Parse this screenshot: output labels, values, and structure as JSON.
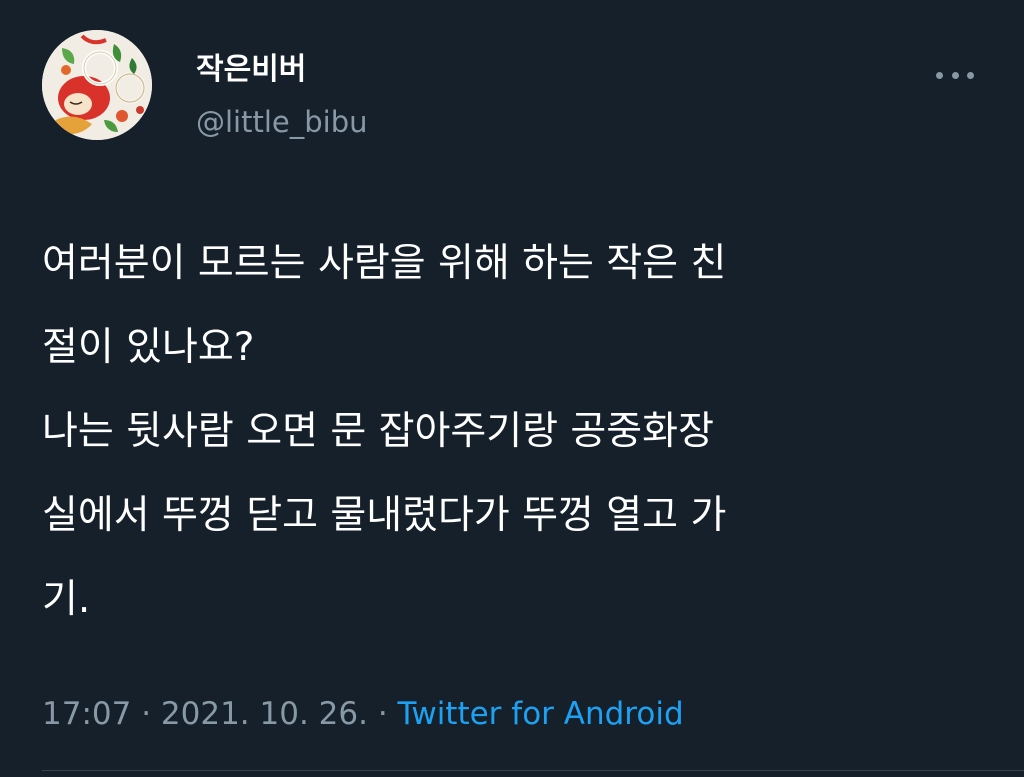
{
  "author": {
    "display_name": "작은비버",
    "handle": "@little_bibu",
    "avatar_icon": "profile-avatar"
  },
  "menu": {
    "icon": "more-horizontal-icon"
  },
  "tweet": {
    "lines": [
      "여러분이 모르는 사람을 위해 하는 작은 친",
      "절이 있나요?",
      "나는 뒷사람 오면 문 잡아주기랑 공중화장",
      "실에서 뚜껑 닫고 물내렸다가 뚜껑 열고 가",
      "기."
    ]
  },
  "meta": {
    "time": "17:07",
    "separator": " · ",
    "date": "2021. 10. 26.",
    "source": "Twitter for Android"
  },
  "colors": {
    "background": "#15202b",
    "primary_text": "#ffffff",
    "secondary_text": "#8899a6",
    "link": "#1da1f2",
    "divider": "#38444d"
  }
}
